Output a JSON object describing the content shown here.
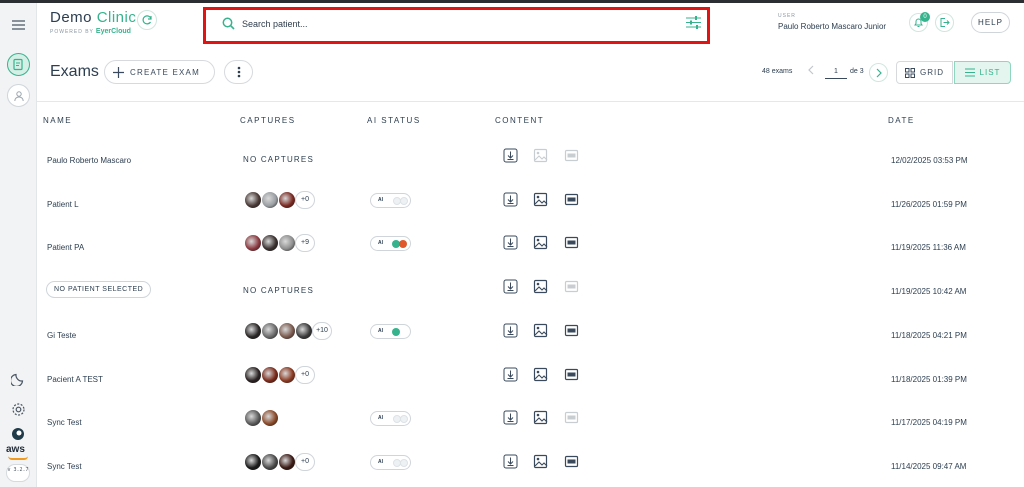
{
  "app": {
    "brand_part1": "Demo",
    "brand_part2": "Clinic",
    "powered_by": "POWERED BY",
    "powered_brand": "EyerCloud",
    "version": "v 3.2.7"
  },
  "search": {
    "placeholder": "Search patient...",
    "value": ""
  },
  "user": {
    "label": "USER",
    "name": "Paulo Roberto Mascaro Junior"
  },
  "notifications": {
    "count": "0"
  },
  "help_label": "HELP",
  "toolbar": {
    "title": "Exams",
    "create_label": "CREATE EXAM",
    "exam_count": "48 exams",
    "page_current": "1",
    "page_of": "de 3",
    "grid_label": "GRID",
    "list_label": "LIST",
    "active_view": "list"
  },
  "columns": [
    "NAME",
    "CAPTURES",
    "AI STATUS",
    "CONTENT",
    "DATE"
  ],
  "colors": {
    "accent": "#35b38c",
    "highlight": "#e11414",
    "ai_orange": "#e0572b"
  },
  "rows": [
    {
      "name": "Paulo Roberto Mascaro",
      "patient_selected": true,
      "captures": "NO CAPTURES",
      "thumbs": [],
      "more": "",
      "ai": "none",
      "image_enabled": false,
      "report_enabled": false,
      "date": "12/02/2025 03:53 PM"
    },
    {
      "name": "Patient L",
      "patient_selected": true,
      "captures": "",
      "thumbs": [
        "#4a3a36",
        "#9a9ea2",
        "#7a2a22"
      ],
      "more": "+0",
      "ai": "off",
      "image_enabled": true,
      "report_enabled": true,
      "date": "11/26/2025 01:59 PM"
    },
    {
      "name": "Patient PA",
      "patient_selected": true,
      "captures": "",
      "thumbs": [
        "#8a3a40",
        "#3a3030",
        "#8e8e8e"
      ],
      "more": "+9",
      "ai": "both",
      "image_enabled": true,
      "report_enabled": true,
      "date": "11/19/2025 11:36 AM"
    },
    {
      "name": "NO PATIENT SELECTED",
      "patient_selected": false,
      "captures": "NO CAPTURES",
      "thumbs": [],
      "more": "",
      "ai": "none",
      "image_enabled": true,
      "report_enabled": false,
      "date": "11/19/2025 10:42 AM"
    },
    {
      "name": "Gi Teste",
      "patient_selected": true,
      "captures": "",
      "thumbs": [
        "#2a2626",
        "#6a6a6a",
        "#7a5a4e",
        "#3a3a3a"
      ],
      "more": "+10",
      "ai": "green",
      "image_enabled": true,
      "report_enabled": true,
      "date": "11/18/2025 04:21 PM"
    },
    {
      "name": "Pacient A TEST",
      "patient_selected": true,
      "captures": "",
      "thumbs": [
        "#2a2222",
        "#7a2a1a",
        "#8a3a22"
      ],
      "more": "+0",
      "ai": "none",
      "image_enabled": true,
      "report_enabled": true,
      "date": "11/18/2025 01:39 PM"
    },
    {
      "name": "Sync Test",
      "patient_selected": true,
      "captures": "",
      "thumbs": [
        "#5a5a5a",
        "#8a4a2a"
      ],
      "more": "",
      "ai": "off",
      "image_enabled": true,
      "report_enabled": false,
      "date": "11/17/2025 04:19 PM"
    },
    {
      "name": "Sync Test",
      "patient_selected": true,
      "captures": "",
      "thumbs": [
        "#1a1a1a",
        "#4a4a4a",
        "#3a1a14"
      ],
      "more": "+0",
      "ai": "off",
      "image_enabled": true,
      "report_enabled": true,
      "date": "11/14/2025 09:47 AM"
    }
  ]
}
